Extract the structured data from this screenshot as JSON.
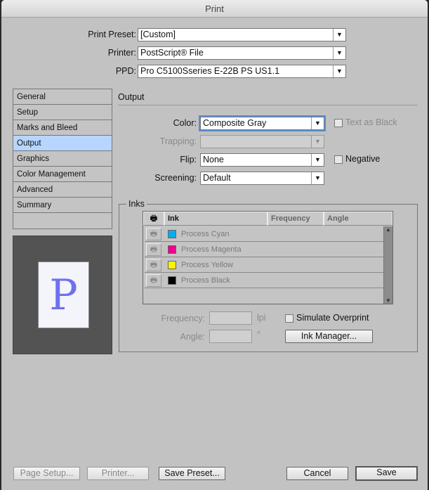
{
  "window": {
    "title": "Print"
  },
  "header": {
    "print_preset": {
      "label": "Print Preset:",
      "value": "[Custom]"
    },
    "printer": {
      "label": "Printer:",
      "value": "PostScript® File"
    },
    "ppd": {
      "label": "PPD:",
      "value": "Pro C5100Sseries E-22B PS US1.1"
    }
  },
  "sidebar": {
    "items": [
      {
        "label": "General"
      },
      {
        "label": "Setup"
      },
      {
        "label": "Marks and Bleed"
      },
      {
        "label": "Output",
        "selected": true
      },
      {
        "label": "Graphics"
      },
      {
        "label": "Color Management"
      },
      {
        "label": "Advanced"
      },
      {
        "label": "Summary"
      }
    ]
  },
  "preview": {
    "glyph": "P"
  },
  "output": {
    "section_title": "Output",
    "color": {
      "label": "Color:",
      "value": "Composite Gray"
    },
    "text_as_black": {
      "label": "Text as Black",
      "checked": false,
      "enabled": false
    },
    "trapping": {
      "label": "Trapping:",
      "value": ""
    },
    "flip": {
      "label": "Flip:",
      "value": "None"
    },
    "negative": {
      "label": "Negative",
      "checked": false
    },
    "screening": {
      "label": "Screening:",
      "value": "Default"
    }
  },
  "inks": {
    "title": "Inks",
    "columns": [
      "Ink",
      "Frequency",
      "Angle"
    ],
    "rows": [
      {
        "name": "Process Cyan",
        "color": "#00aeef"
      },
      {
        "name": "Process Magenta",
        "color": "#ec008c"
      },
      {
        "name": "Process Yellow",
        "color": "#fff200"
      },
      {
        "name": "Process Black",
        "color": "#000000"
      }
    ],
    "frequency": {
      "label": "Frequency:",
      "value": "",
      "unit": "lpi"
    },
    "angle": {
      "label": "Angle:",
      "value": "",
      "unit": "°"
    },
    "simulate_overprint": {
      "label": "Simulate Overprint",
      "checked": false
    },
    "ink_manager": "Ink Manager..."
  },
  "footer": {
    "page_setup": "Page Setup...",
    "printer": "Printer...",
    "save_preset": "Save Preset...",
    "cancel": "Cancel",
    "save": "Save"
  }
}
